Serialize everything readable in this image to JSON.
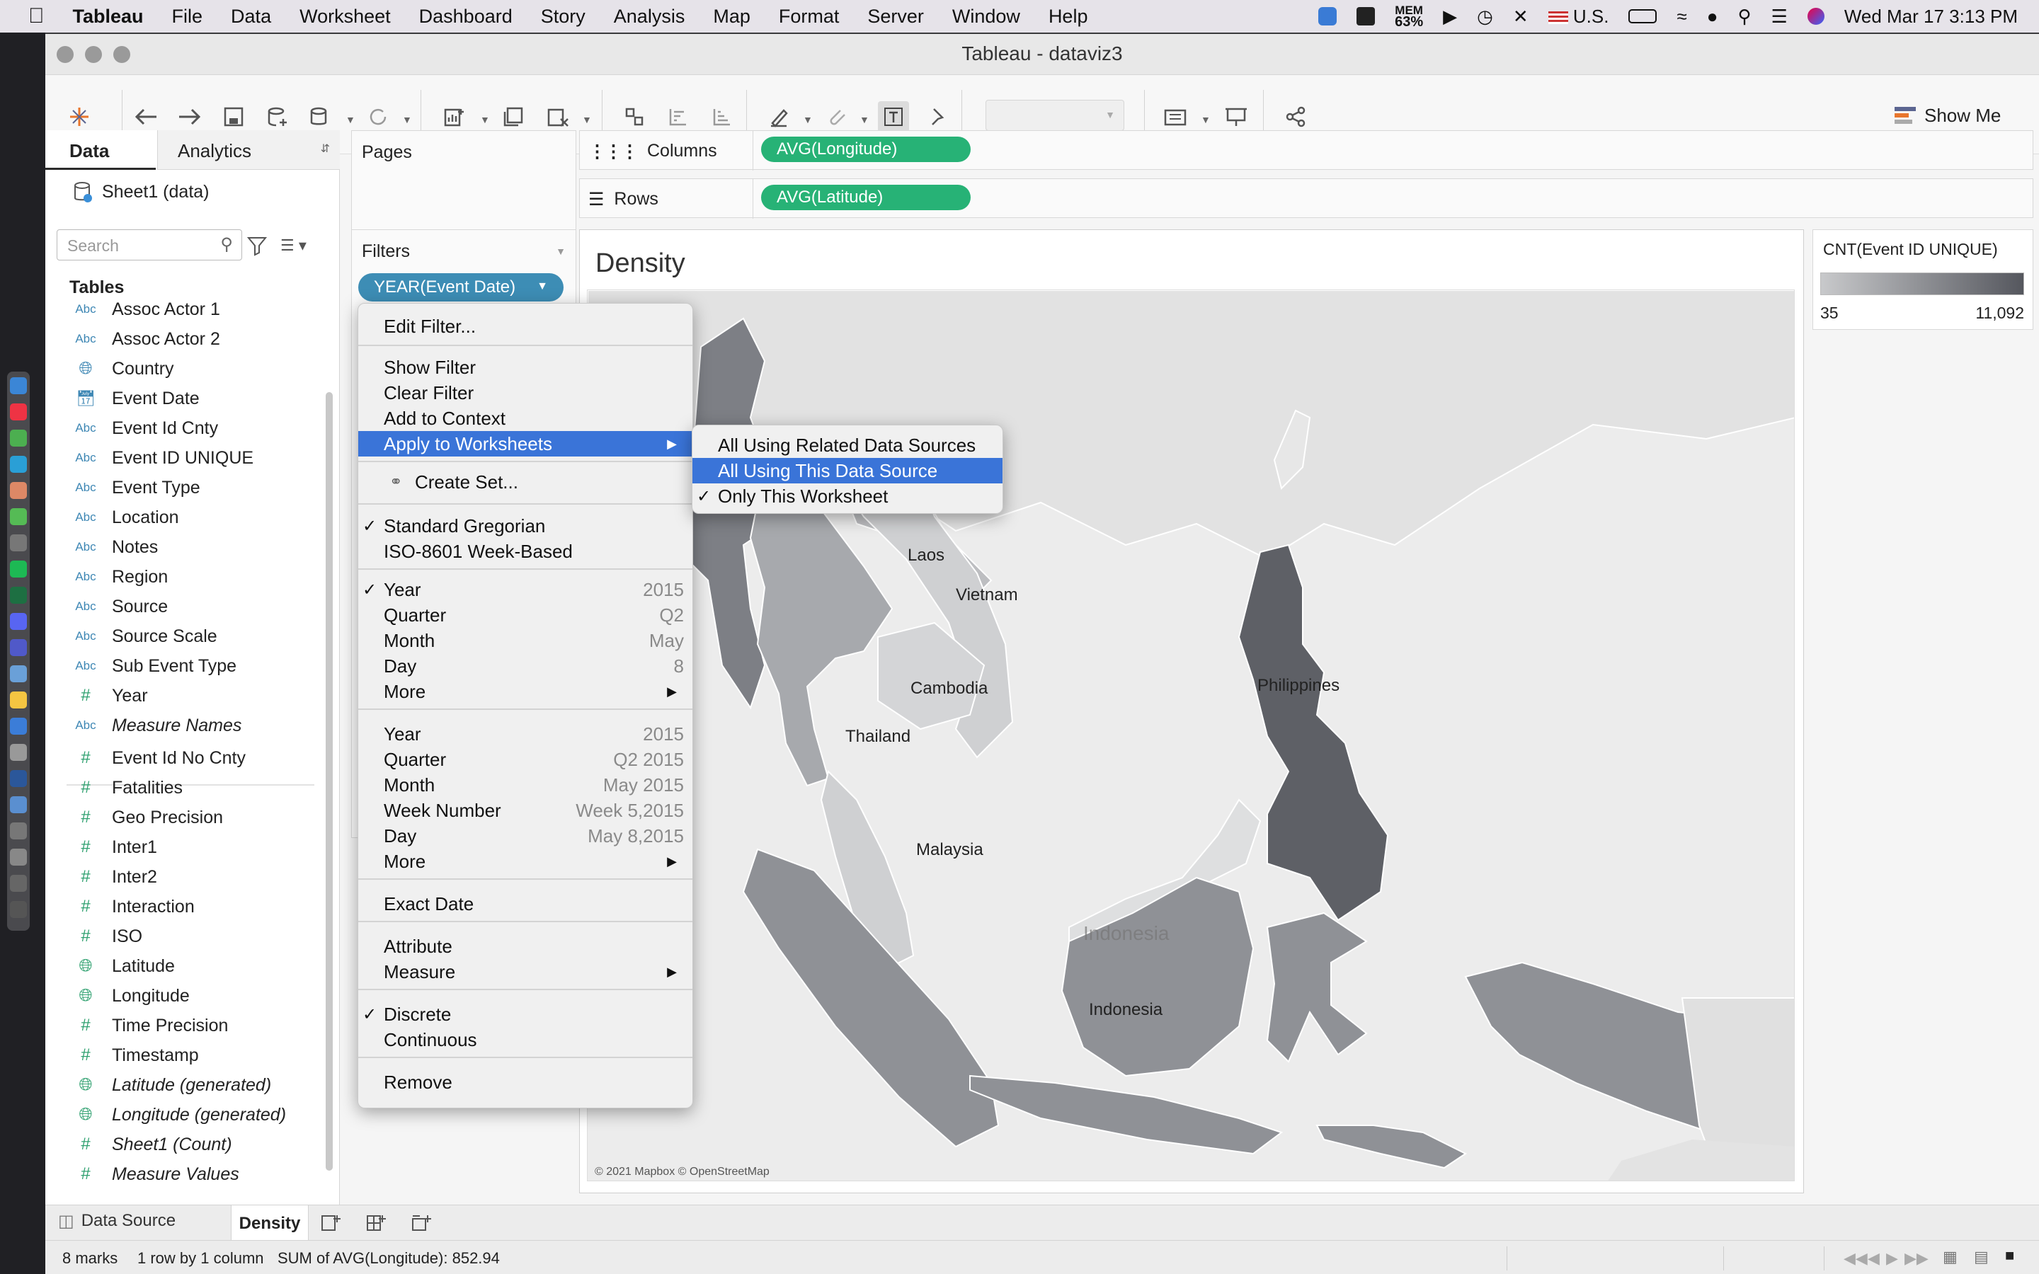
{
  "menubar": {
    "app": "Tableau",
    "items": [
      "File",
      "Data",
      "Worksheet",
      "Dashboard",
      "Story",
      "Analysis",
      "Map",
      "Format",
      "Server",
      "Window",
      "Help"
    ],
    "mem_label": "MEM",
    "mem_value": "63%",
    "input_source": "U.S.",
    "datetime": "Wed Mar 17  3:13 PM"
  },
  "window": {
    "title": "Tableau - dataviz3"
  },
  "toolbar": {
    "show_me": "Show Me"
  },
  "data_pane": {
    "tab_data": "Data",
    "tab_analytics": "Analytics",
    "datasource": "Sheet1 (data)",
    "search_placeholder": "Search",
    "tables_header": "Tables",
    "fields": [
      {
        "type": "Abc",
        "name": "Assoc Actor 1"
      },
      {
        "type": "Abc",
        "name": "Assoc Actor 2"
      },
      {
        "type": "geo",
        "name": "Country"
      },
      {
        "type": "date",
        "name": "Event Date"
      },
      {
        "type": "Abc",
        "name": "Event Id Cnty"
      },
      {
        "type": "Abc",
        "name": "Event ID UNIQUE"
      },
      {
        "type": "Abc",
        "name": "Event Type"
      },
      {
        "type": "Abc",
        "name": "Location"
      },
      {
        "type": "Abc",
        "name": "Notes"
      },
      {
        "type": "Abc",
        "name": "Region"
      },
      {
        "type": "Abc",
        "name": "Source"
      },
      {
        "type": "Abc",
        "name": "Source Scale"
      },
      {
        "type": "Abc",
        "name": "Sub Event Type"
      },
      {
        "type": "#",
        "name": "Year"
      },
      {
        "type": "Abc",
        "name": "Measure Names",
        "italic": true
      }
    ],
    "measures": [
      {
        "type": "#",
        "name": "Event Id No Cnty"
      },
      {
        "type": "#",
        "name": "Fatalities"
      },
      {
        "type": "#",
        "name": "Geo Precision"
      },
      {
        "type": "#",
        "name": "Inter1"
      },
      {
        "type": "#",
        "name": "Inter2"
      },
      {
        "type": "#",
        "name": "Interaction"
      },
      {
        "type": "#",
        "name": "ISO"
      },
      {
        "type": "geo",
        "name": "Latitude"
      },
      {
        "type": "geo",
        "name": "Longitude"
      },
      {
        "type": "#",
        "name": "Time Precision"
      },
      {
        "type": "#",
        "name": "Timestamp"
      },
      {
        "type": "geo",
        "name": "Latitude (generated)",
        "italic": true
      },
      {
        "type": "geo",
        "name": "Longitude (generated)",
        "italic": true
      },
      {
        "type": "#",
        "name": "Sheet1 (Count)",
        "italic": true
      },
      {
        "type": "#",
        "name": "Measure Values",
        "italic": true
      }
    ]
  },
  "shelves": {
    "pages": "Pages",
    "filters": "Filters",
    "filter_pill": "YEAR(Event Date)",
    "columns_label": "Columns",
    "columns_pill": "AVG(Longitude)",
    "rows_label": "Rows",
    "rows_pill": "AVG(Latitude)"
  },
  "viz": {
    "title": "Density",
    "attribution": "© 2021 Mapbox © OpenStreetMap",
    "labels": {
      "laos": "Laos",
      "vietnam": "Vietnam",
      "cambodia": "Cambodia",
      "thailand": "Thailand",
      "philippines": "Philippines",
      "malaysia": "Malaysia",
      "indonesia_big": "Indonesia",
      "indonesia": "Indonesia"
    }
  },
  "legend": {
    "title": "CNT(Event ID UNIQUE)",
    "min": "35",
    "max": "11,092"
  },
  "context_menu": {
    "edit_filter": "Edit Filter...",
    "show_filter": "Show Filter",
    "clear_filter": "Clear Filter",
    "add_context": "Add to Context",
    "apply_ws": "Apply to Worksheets",
    "create_set": "Create Set...",
    "std_greg": "Standard Gregorian",
    "iso_week": "ISO-8601 Week-Based",
    "p1_year": "Year",
    "p1_year_v": "2015",
    "p1_quarter": "Quarter",
    "p1_quarter_v": "Q2",
    "p1_month": "Month",
    "p1_month_v": "May",
    "p1_day": "Day",
    "p1_day_v": "8",
    "p1_more": "More",
    "p2_year": "Year",
    "p2_year_v": "2015",
    "p2_quarter": "Quarter",
    "p2_quarter_v": "Q2 2015",
    "p2_month": "Month",
    "p2_month_v": "May 2015",
    "p2_week": "Week Number",
    "p2_week_v": "Week 5,2015",
    "p2_day": "Day",
    "p2_day_v": "May 8,2015",
    "p2_more": "More",
    "exact_date": "Exact Date",
    "attribute": "Attribute",
    "measure": "Measure",
    "discrete": "Discrete",
    "continuous": "Continuous",
    "remove": "Remove"
  },
  "submenu": {
    "related": "All Using Related Data Sources",
    "this_source": "All Using This Data Source",
    "only_this": "Only This Worksheet"
  },
  "sheet_tabs": {
    "datasource": "Data Source",
    "sheet": "Density"
  },
  "status": {
    "marks": "8 marks",
    "rows_cols": "1 row by 1 column",
    "sum": "SUM of AVG(Longitude): 852.94"
  },
  "colors": {
    "pill_green": "#27b276",
    "filter_blue": "#3d8db5",
    "highlight": "#3a74d8"
  }
}
